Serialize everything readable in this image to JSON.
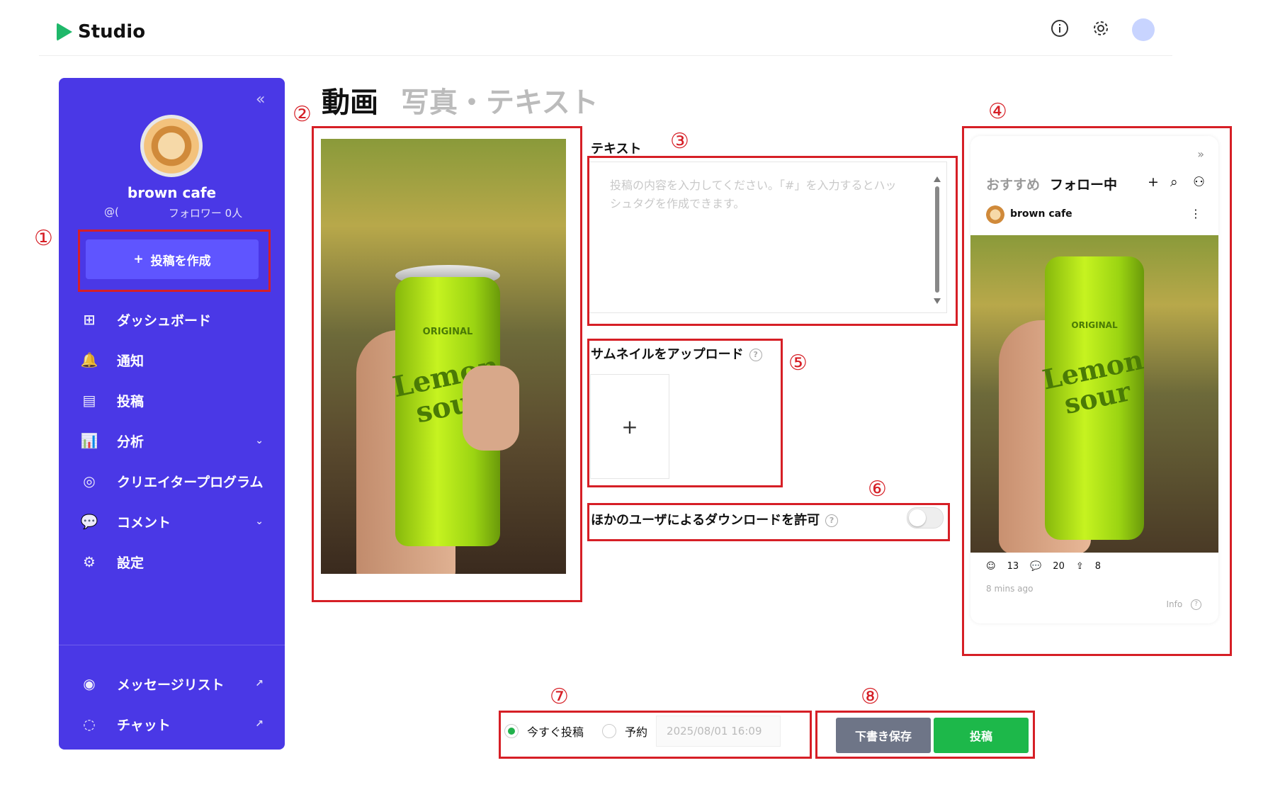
{
  "app": {
    "title": "Studio"
  },
  "header": {
    "icons": [
      "info-icon",
      "gear-icon",
      "avatar"
    ]
  },
  "sidebar": {
    "collapse_icon": "«",
    "profile": {
      "name": "brown cafe",
      "handle": "@(",
      "followers": "フォロワー 0人"
    },
    "create_button": {
      "icon": "+",
      "label": "投稿を作成"
    },
    "items": [
      {
        "icon": "⊞",
        "label": "ダッシュボード"
      },
      {
        "icon": "🔔",
        "label": "通知"
      },
      {
        "icon": "▤",
        "label": "投稿"
      },
      {
        "icon": "📊",
        "label": "分析",
        "chevron": "⌄"
      },
      {
        "icon": "◎",
        "label": "クリエイタープログラム"
      },
      {
        "icon": "💬",
        "label": "コメント",
        "chevron": "⌄"
      },
      {
        "icon": "⚙",
        "label": "設定"
      }
    ],
    "bottom_items": [
      {
        "icon": "◉",
        "label": "メッセージリスト",
        "external": "↗"
      },
      {
        "icon": "◌",
        "label": "チャット",
        "external": "↗"
      }
    ]
  },
  "tabs": {
    "video": "動画",
    "photo_text": "写真・テキスト"
  },
  "form": {
    "text_label": "テキスト",
    "text_placeholder": "投稿の内容を入力してください。「#」を入力するとハッシュタグを作成できます。",
    "thumbnail_label": "サムネイルをアップロード",
    "thumbnail_plus": "+",
    "help_mark": "?",
    "download_label": "ほかのユーザによるダウンロードを許可",
    "download_allowed": false
  },
  "media": {
    "can_text": "Lemon sour",
    "can_top_text": "ORIGINAL"
  },
  "preview": {
    "expand_icon": "»",
    "tab_recommended": "おすすめ",
    "tab_following": "フォロー中",
    "header_icons": [
      "+",
      "⌕",
      "⚇"
    ],
    "user": "brown cafe",
    "more": "⋮",
    "likes": "13",
    "comments": "20",
    "shares": "8",
    "time": "8 mins ago",
    "info": "Info"
  },
  "schedule": {
    "now_label": "今すぐ投稿",
    "reserve_label": "予約",
    "datetime": "2025/08/01 16:09",
    "selected": "now"
  },
  "actions": {
    "draft": "下書き保存",
    "post": "投稿"
  },
  "annotations": [
    "①",
    "②",
    "③",
    "④",
    "⑤",
    "⑥",
    "⑦",
    "⑧"
  ],
  "colors": {
    "sidebar": "#4a38e6",
    "create_button": "#5f55ff",
    "post_button": "#1db84a",
    "draft_button": "#6e7587",
    "annotation": "#d61f26"
  }
}
